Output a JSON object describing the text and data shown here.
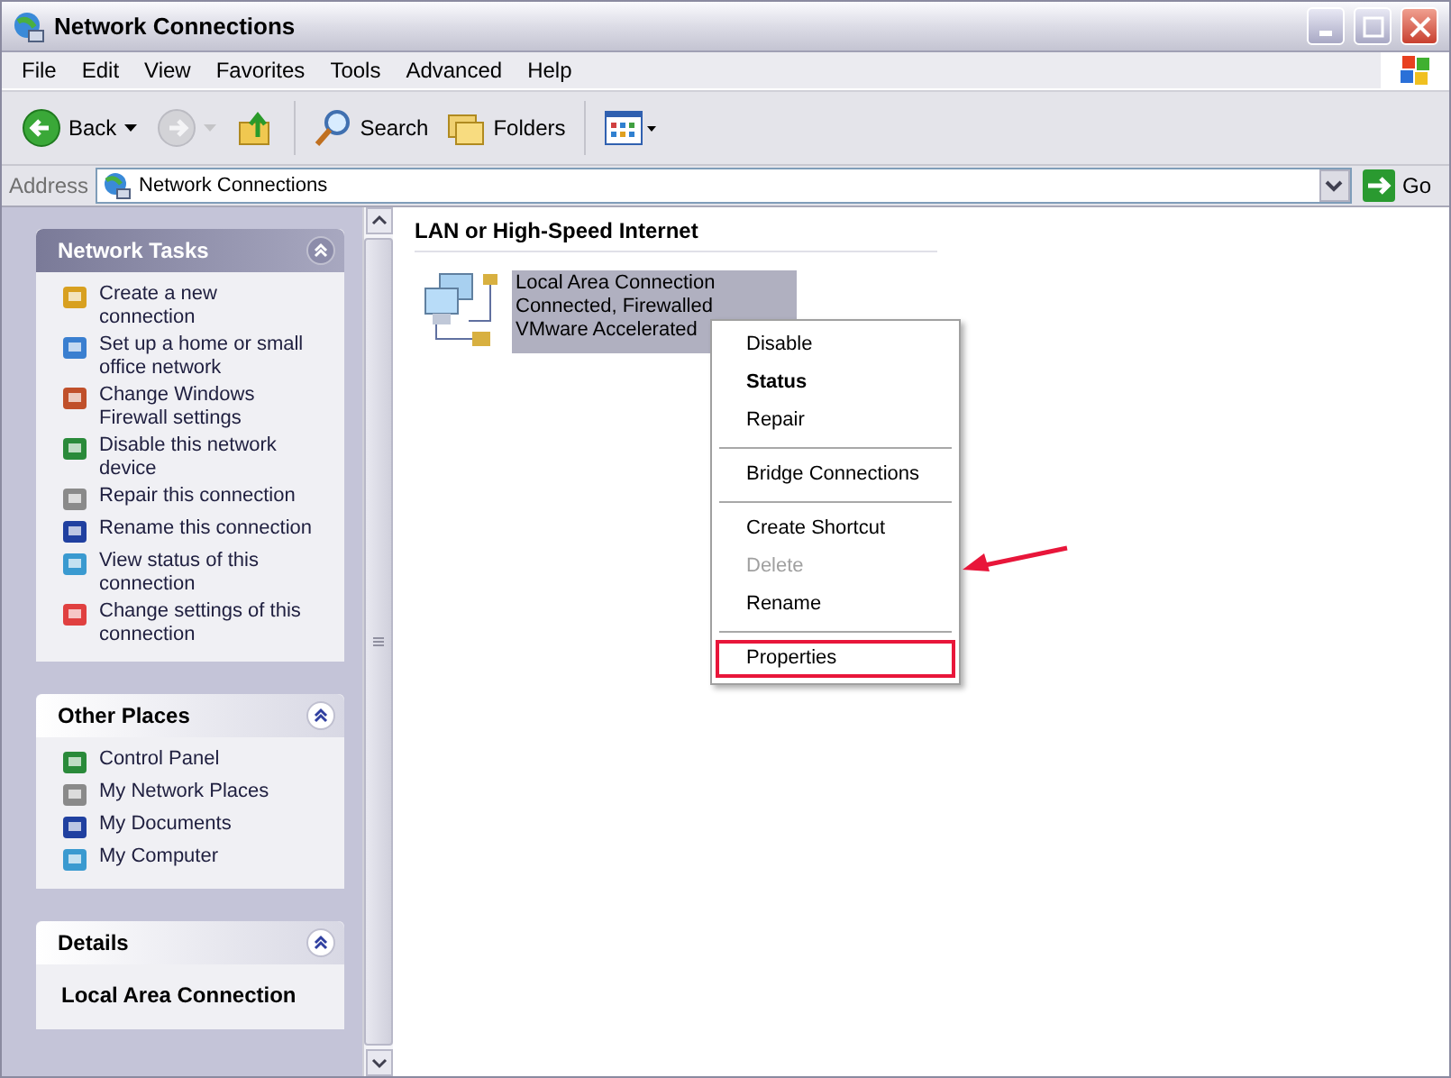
{
  "window": {
    "title": "Network Connections"
  },
  "menu_bar": [
    "File",
    "Edit",
    "View",
    "Favorites",
    "Tools",
    "Advanced",
    "Help"
  ],
  "toolbar": [
    {
      "kind": "back",
      "label": "Back",
      "disabled": false
    },
    {
      "kind": "forward",
      "disabled": true
    },
    {
      "kind": "up",
      "disabled": false
    },
    {
      "kind": "search",
      "label": "Search",
      "disabled": false
    },
    {
      "kind": "folders",
      "label": "Folders",
      "disabled": false
    },
    {
      "kind": "views",
      "disabled": false
    }
  ],
  "address_bar": {
    "label": "Address",
    "value": "Network Connections",
    "go": "Go"
  },
  "task_pane": [
    {
      "title": "Network Tasks",
      "kind": "special",
      "items": [
        "Create a new connection",
        "Set up a home or small office network",
        "Change Windows Firewall settings",
        "Disable this network device",
        "Repair this connection",
        "Rename this connection",
        "View status of this connection",
        "Change settings of this connection"
      ]
    },
    {
      "title": "Other Places",
      "kind": "normal",
      "items": [
        "Control Panel",
        "My Network Places",
        "My Documents",
        "My Computer"
      ]
    },
    {
      "title": "Details",
      "kind": "details",
      "items": [
        "Local Area Connection"
      ]
    }
  ],
  "content": {
    "group_heading": "LAN or High-Speed Internet",
    "connections": [
      {
        "lines": [
          "Local Area Connection",
          "Connected, Firewalled",
          "VMware Accelerated"
        ],
        "selected": true
      }
    ]
  },
  "context_menu": [
    {
      "kind": "item",
      "label": "Disable",
      "default": false,
      "disabled": false,
      "highlighted": false
    },
    {
      "kind": "item",
      "label": "Status",
      "default": true,
      "disabled": false,
      "highlighted": false
    },
    {
      "kind": "item",
      "label": "Repair",
      "default": false,
      "disabled": false,
      "highlighted": false
    },
    {
      "kind": "separator"
    },
    {
      "kind": "item",
      "label": "Bridge Connections",
      "default": false,
      "disabled": false,
      "highlighted": false
    },
    {
      "kind": "separator"
    },
    {
      "kind": "item",
      "label": "Create Shortcut",
      "default": false,
      "disabled": false,
      "highlighted": false
    },
    {
      "kind": "item",
      "label": "Delete",
      "default": false,
      "disabled": true,
      "highlighted": false
    },
    {
      "kind": "item",
      "label": "Rename",
      "default": false,
      "disabled": false,
      "highlighted": false
    },
    {
      "kind": "separator"
    },
    {
      "kind": "item",
      "label": "Properties",
      "default": false,
      "disabled": false,
      "highlighted": true
    }
  ]
}
